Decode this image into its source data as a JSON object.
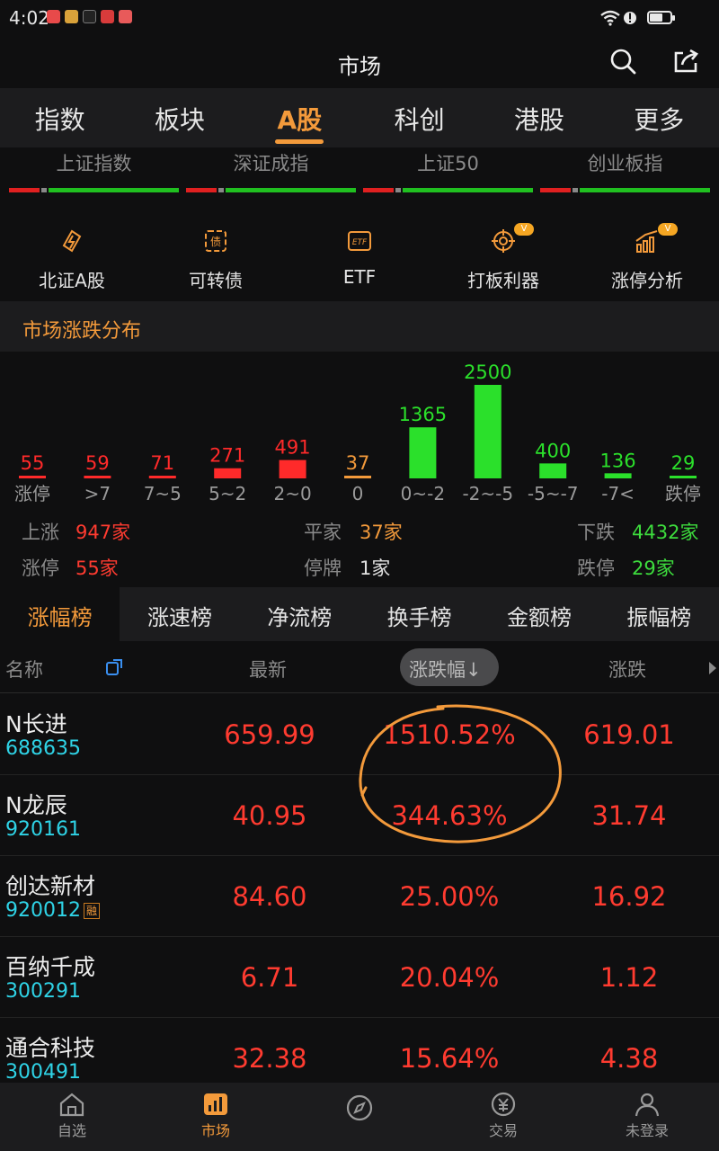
{
  "status_bar": {
    "time": "4:02"
  },
  "title_bar": {
    "title": "市场"
  },
  "main_tabs": [
    {
      "label": "指数"
    },
    {
      "label": "板块"
    },
    {
      "label": "A股"
    },
    {
      "label": "科创"
    },
    {
      "label": "港股"
    },
    {
      "label": "更多"
    }
  ],
  "indices": [
    {
      "name": "上证指数"
    },
    {
      "name": "深证成指"
    },
    {
      "name": "上证50"
    },
    {
      "name": "创业板指"
    }
  ],
  "tools": [
    {
      "label": "北证A股",
      "icon": "bse-icon"
    },
    {
      "label": "可转债",
      "icon": "bond-icon",
      "icon_text": "债"
    },
    {
      "label": "ETF",
      "icon": "etf-icon",
      "icon_text": "ETF"
    },
    {
      "label": "打板利器",
      "icon": "target-icon",
      "badge": "V"
    },
    {
      "label": "涨停分析",
      "icon": "trend-chart-icon",
      "badge": "V"
    }
  ],
  "distribution": {
    "title": "市场涨跌分布"
  },
  "chart_data": {
    "type": "bar",
    "categories": [
      "涨停",
      ">7",
      "7~5",
      "5~2",
      "2~0",
      "0",
      "0~-2",
      "-2~-5",
      "-5~-7",
      "-7<",
      "跌停"
    ],
    "values": [
      55,
      59,
      71,
      271,
      491,
      37,
      1365,
      2500,
      400,
      136,
      29
    ],
    "colors": [
      "#ff2a2a",
      "#ff2a2a",
      "#ff2a2a",
      "#ff2a2a",
      "#ff2a2a",
      "#f39a3b",
      "#2be02b",
      "#2be02b",
      "#2be02b",
      "#2be02b",
      "#2be02b"
    ],
    "title": "",
    "xlabel": "",
    "ylabel": ""
  },
  "summary": {
    "up_label": "上涨",
    "up_value": "947家",
    "flat_label": "平家",
    "flat_value": "37家",
    "down_label": "下跌",
    "down_value": "4432家",
    "limit_up_label": "涨停",
    "limit_up_value": "55家",
    "halt_label": "停牌",
    "halt_value": "1家",
    "limit_down_label": "跌停",
    "limit_down_value": "29家"
  },
  "rank_tabs": [
    {
      "label": "涨幅榜"
    },
    {
      "label": "涨速榜"
    },
    {
      "label": "净流榜"
    },
    {
      "label": "换手榜"
    },
    {
      "label": "金额榜"
    },
    {
      "label": "振幅榜"
    }
  ],
  "table": {
    "headers": {
      "name": "名称",
      "latest": "最新",
      "change_pct": "涨跌幅↓",
      "change": "涨跌"
    },
    "rows": [
      {
        "name": "N长进",
        "code": "688635",
        "latest": "659.99",
        "change_pct": "1510.52%",
        "change": "619.01"
      },
      {
        "name": "N龙辰",
        "code": "920161",
        "latest": "40.95",
        "change_pct": "344.63%",
        "change": "31.74"
      },
      {
        "name": "创达新材",
        "code": "920012",
        "tag": "融",
        "latest": "84.60",
        "change_pct": "25.00%",
        "change": "16.92"
      },
      {
        "name": "百纳千成",
        "code": "300291",
        "latest": "6.71",
        "change_pct": "20.04%",
        "change": "1.12"
      },
      {
        "name": "通合科技",
        "code": "300491",
        "latest": "32.38",
        "change_pct": "15.64%",
        "change": "4.38"
      }
    ]
  },
  "bottom_nav": [
    {
      "label": "自选",
      "icon": "home-icon"
    },
    {
      "label": "市场",
      "icon": "market-icon"
    },
    {
      "label": "",
      "icon": "compass-icon"
    },
    {
      "label": "交易",
      "icon": "trade-icon"
    },
    {
      "label": "未登录",
      "icon": "user-icon"
    }
  ],
  "colors": {
    "accent": "#f39a3b",
    "up": "#ff3b30",
    "down": "#3ddc3d",
    "code": "#2fd3e6"
  }
}
